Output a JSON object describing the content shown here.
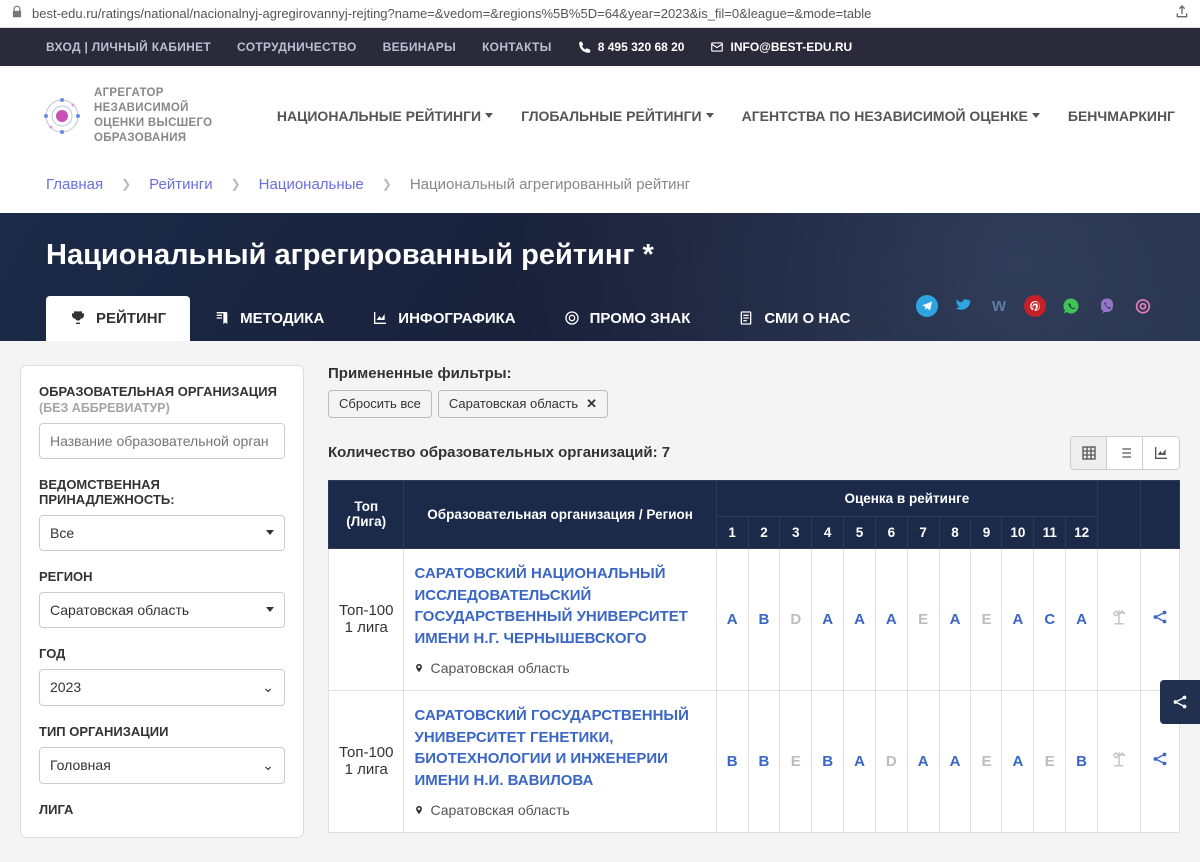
{
  "url": "best-edu.ru/ratings/national/nacionalnyj-agregirovannyj-rejting?name=&vedom=&regions%5B%5D=64&year=2023&is_fil=0&league=&mode=table",
  "topbar": {
    "links": [
      "ВХОД | ЛИЧНЫЙ КАБИНЕТ",
      "СОТРУДНИЧЕСТВО",
      "ВЕБИНАРЫ",
      "КОНТАКТЫ"
    ],
    "phone": "8 495 320 68 20",
    "email": "INFO@BEST-EDU.RU"
  },
  "brand": {
    "line1": "АГРЕГАТОР НЕЗАВИСИМОЙ",
    "line2": "ОЦЕНКИ ВЫСШЕГО",
    "line3": "ОБРАЗОВАНИЯ"
  },
  "main_nav": {
    "items": [
      "НАЦИОНАЛЬНЫЕ РЕЙТИНГИ",
      "ГЛОБАЛЬНЫЕ РЕЙТИНГИ",
      "АГЕНТСТВА ПО НЕЗАВИСИМОЙ ОЦЕНКЕ",
      "БЕНЧМАРКИНГ"
    ],
    "has_caret": [
      true,
      true,
      true,
      false
    ]
  },
  "breadcrumbs": [
    "Главная",
    "Рейтинги",
    "Национальные",
    "Национальный агрегированный рейтинг"
  ],
  "hero": {
    "title": "Национальный агрегированный рейтинг *",
    "tabs": [
      "РЕЙТИНГ",
      "МЕТОДИКА",
      "ИНФОГРАФИКА",
      "ПРОМО ЗНАК",
      "СМИ О НАС"
    ]
  },
  "sidebar": {
    "org_label": "ОБРАЗОВАТЕЛЬНАЯ ОРГАНИЗАЦИЯ",
    "org_sub": "(БЕЗ АББРЕВИАТУР)",
    "org_placeholder": "Название образовательной орган",
    "depart_label1": "ВЕДОМСТВЕННАЯ",
    "depart_label2": "ПРИНАДЛЕЖНОСТЬ:",
    "depart_value": "Все",
    "region_label": "РЕГИОН",
    "region_value": "Саратовская область",
    "year_label": "ГОД",
    "year_value": "2023",
    "type_label": "ТИП ОРГАНИЗАЦИИ",
    "type_value": "Головная",
    "league_label": "ЛИГА"
  },
  "filters": {
    "title": "Примененные фильтры:",
    "reset": "Сбросить все",
    "chip1": "Саратовская область"
  },
  "count_label": "Количество образовательных организаций: 7",
  "table": {
    "h_top": "Топ",
    "h_top2": "(Лига)",
    "h_org": "Образовательная организация / Регион",
    "h_score": "Оценка в рейтинге",
    "cols": [
      "1",
      "2",
      "3",
      "4",
      "5",
      "6",
      "7",
      "8",
      "9",
      "10",
      "11",
      "12"
    ],
    "rows": [
      {
        "top": "Топ-100",
        "league": "1 лига",
        "name": "САРАТОВСКИЙ НАЦИОНАЛЬНЫЙ ИССЛЕДОВАТЕЛЬСКИЙ ГОСУДАРСТВЕННЫЙ УНИВЕРСИТЕТ ИМЕНИ Н.Г. ЧЕРНЫШЕВСКОГО",
        "region": "Саратовская область",
        "grades": [
          "A",
          "B",
          "D",
          "A",
          "A",
          "A",
          "E",
          "A",
          "E",
          "A",
          "C",
          "A"
        ]
      },
      {
        "top": "Топ-100",
        "league": "1 лига",
        "name": "САРАТОВСКИЙ ГОСУДАРСТВЕННЫЙ УНИВЕРСИТЕТ ГЕНЕТИКИ, БИОТЕХНОЛОГИИ И ИНЖЕНЕРИИ ИМЕНИ Н.И. ВАВИЛОВА",
        "region": "Саратовская область",
        "grades": [
          "B",
          "B",
          "E",
          "B",
          "A",
          "D",
          "A",
          "A",
          "E",
          "A",
          "E",
          "B"
        ]
      }
    ]
  }
}
